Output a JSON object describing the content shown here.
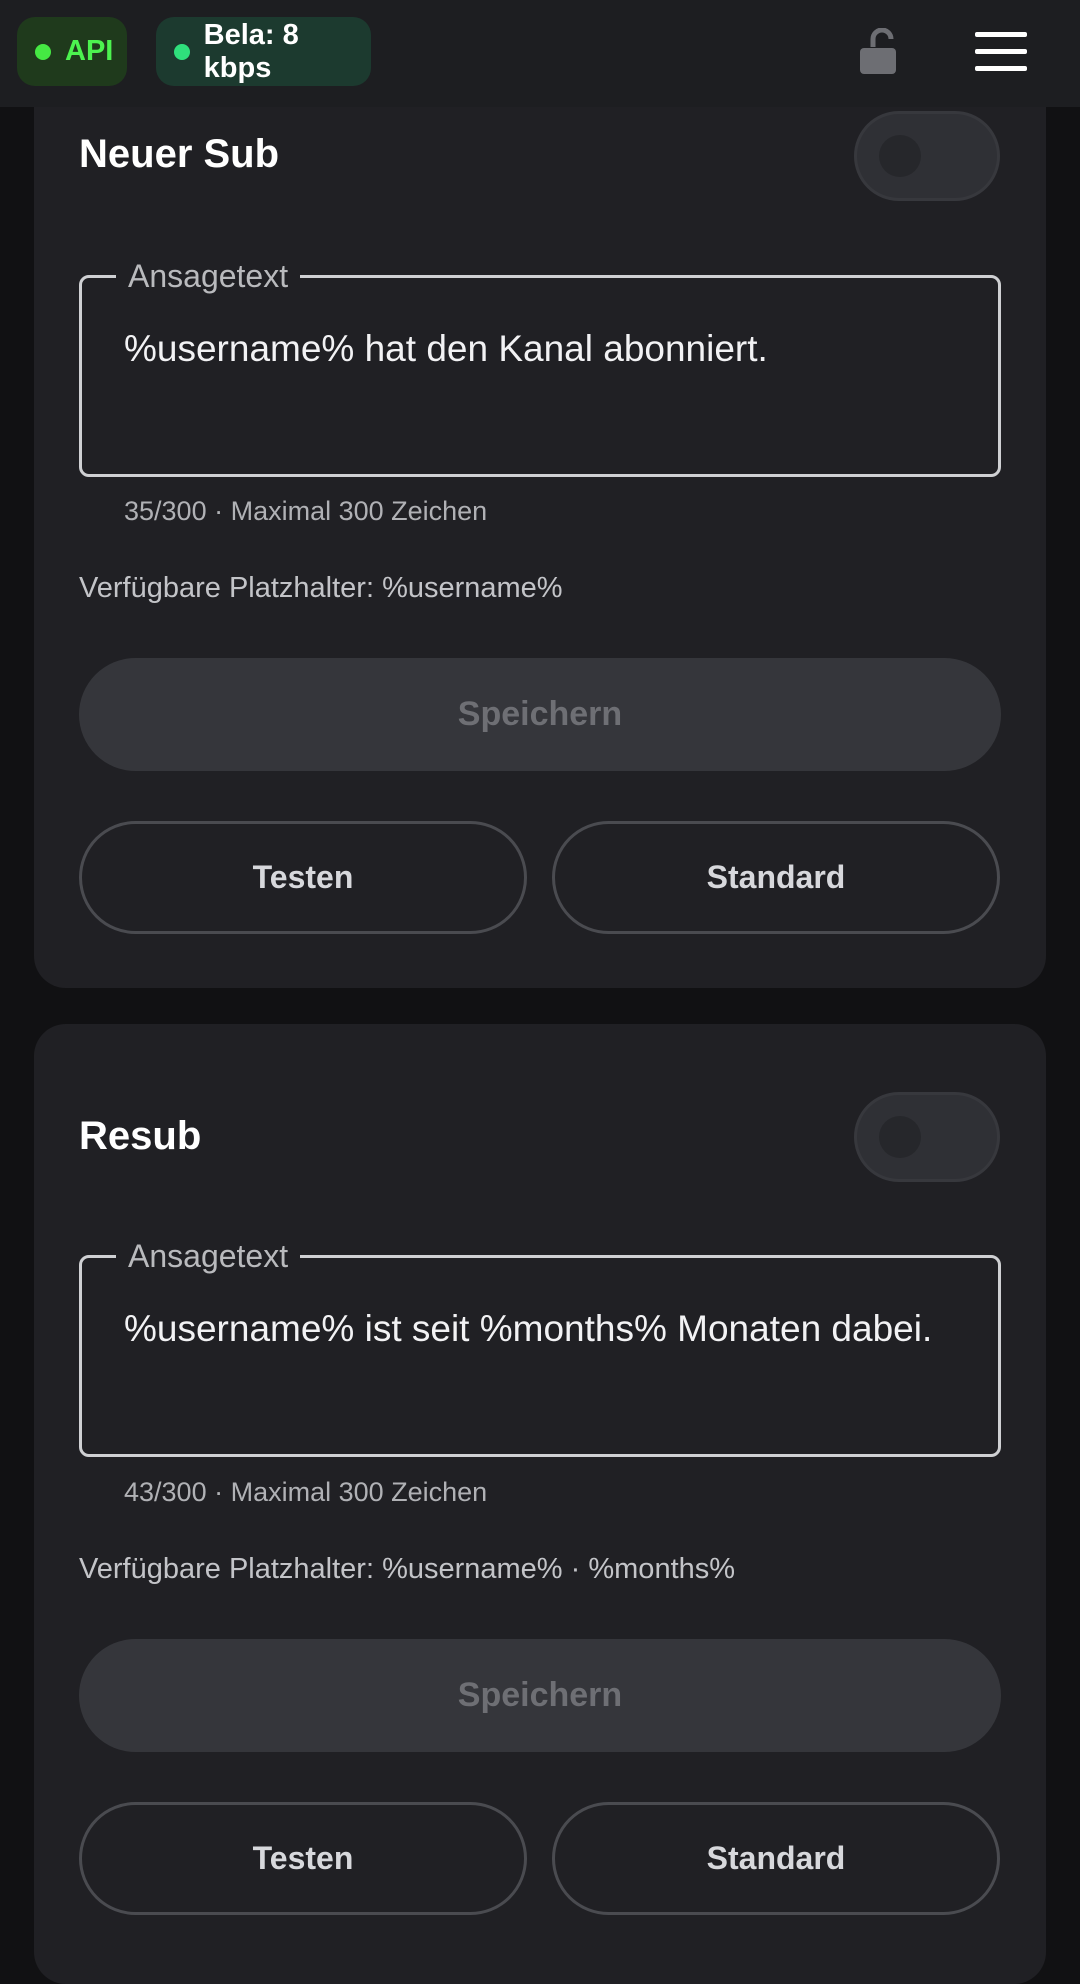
{
  "topbar": {
    "api_label": "API",
    "bela_label": "Bela: 8 kbps",
    "colors": {
      "api_dot": "#45e843",
      "bela_dot": "#2fe07c",
      "background": "#1d1e21"
    },
    "lock_icon": "unlocked-lock-icon",
    "menu_icon": "hamburger-menu-icon"
  },
  "cards": [
    {
      "title": "Neuer Sub",
      "toggle_on": false,
      "field_label": "Ansagetext",
      "field_value": "%username% hat den Kanal abonniert.",
      "helper": "35/300 · Maximal 300 Zeichen",
      "placeholders": "Verfügbare Platzhalter: %username%",
      "save_label": "Speichern",
      "test_label": "Testen",
      "default_label": "Standard"
    },
    {
      "title": "Resub",
      "toggle_on": false,
      "field_label": "Ansagetext",
      "field_value": "%username% ist seit %months% Monaten dabei.",
      "helper": "43/300 · Maximal 300 Zeichen",
      "placeholders": "Verfügbare Platzhalter: %username% · %months%",
      "save_label": "Speichern",
      "test_label": "Testen",
      "default_label": "Standard"
    }
  ]
}
